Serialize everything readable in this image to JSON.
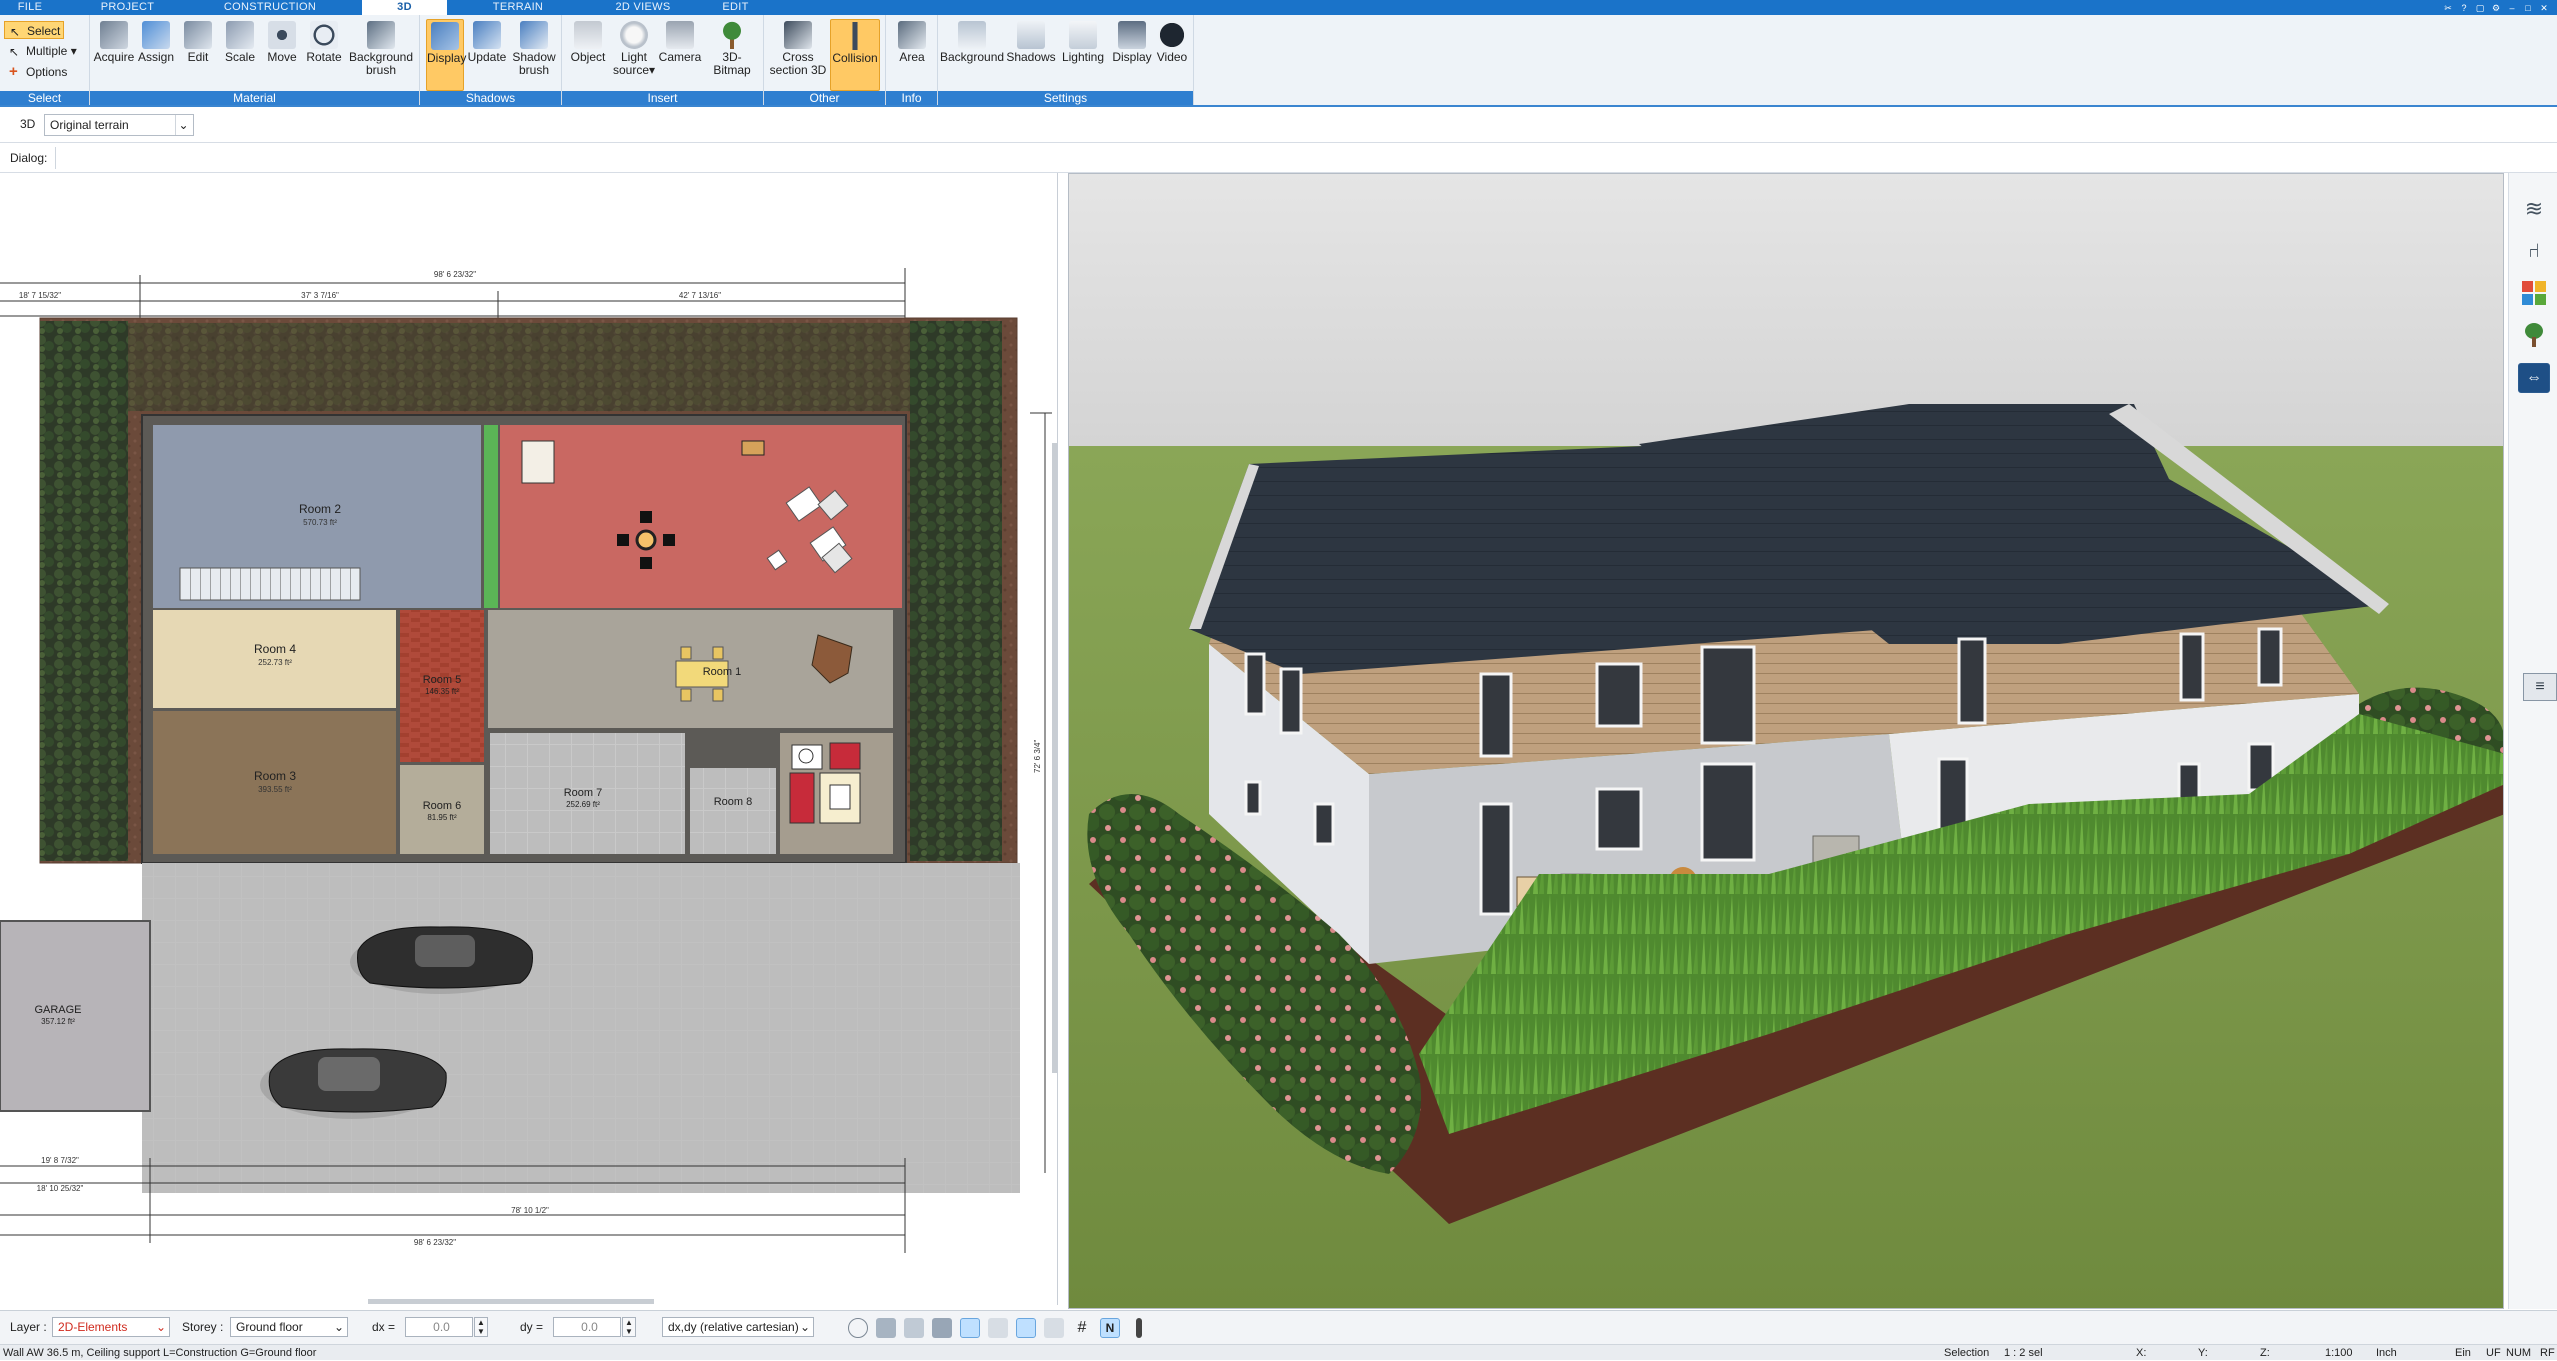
{
  "tabs": [
    {
      "label": "FILE"
    },
    {
      "label": "PROJECT"
    },
    {
      "label": "CONSTRUCTION"
    },
    {
      "label": "3D"
    },
    {
      "label": "TERRAIN"
    },
    {
      "label": "2D VIEWS"
    },
    {
      "label": "EDIT"
    }
  ],
  "ribbon": {
    "select_group": {
      "label": "Select",
      "select": "Select",
      "multiple": "Multiple",
      "options": "Options"
    },
    "material_group": {
      "label": "Material",
      "buttons": [
        "Acquire",
        "Assign",
        "Edit",
        "Scale",
        "Move",
        "Rotate",
        "Background",
        "brush"
      ]
    },
    "shadows_group": {
      "label": "Shadows",
      "buttons": [
        "Display",
        "Update",
        "Shadow",
        "brush"
      ]
    },
    "insert_group": {
      "label": "Insert",
      "buttons": [
        "Object",
        "Light",
        "source",
        "Camera",
        "3D-Bitmap"
      ]
    },
    "other_group": {
      "label": "Other",
      "buttons": [
        "Cross",
        "section 3D",
        "Collision"
      ]
    },
    "info_group": {
      "label": "Info",
      "buttons": [
        "Area"
      ]
    },
    "settings_group": {
      "label": "Settings",
      "buttons": [
        "Background",
        "Shadows",
        "Lighting",
        "Display",
        "Video"
      ]
    }
  },
  "viewbar": {
    "mode": "3D",
    "terrain": "Original terrain"
  },
  "dialogbar": {
    "label": "Dialog:"
  },
  "plan": {
    "rooms": [
      {
        "name": "Room 2",
        "area": "570.73 ft²"
      },
      {
        "name": "Room 4",
        "area": "252.73 ft²"
      },
      {
        "name": "Room 3",
        "area": "393.55 ft²"
      },
      {
        "name": "Room 5",
        "area": "146.35 ft²"
      },
      {
        "name": "Room 1",
        "area": ""
      },
      {
        "name": "Room 6",
        "area": "81.95 ft²"
      },
      {
        "name": "Room 7",
        "area": "252.69 ft²"
      },
      {
        "name": "Room 8",
        "area": ""
      },
      {
        "name": "GARAGE",
        "area": "357.12 ft²"
      }
    ],
    "dims": {
      "top_total": "98' 6 23/32\"",
      "top_left": "37' 3 7/16\"",
      "top_right": "42' 7 13/16\"",
      "top_far_left": "18' 7 15/32\"",
      "bottom_total": "98' 6 23/32\"",
      "bottom_mid": "78' 10 1/2\"",
      "bottom_left": "19' 8 7/32\"",
      "left_side": "18' 10 25/32\"",
      "right_side": "72' 6 3/4\""
    }
  },
  "optbar": {
    "layer_label": "Layer :",
    "layer_value": "2D-Elements",
    "storey_label": "Storey :",
    "storey_value": "Ground floor",
    "dx_label": "dx =",
    "dx_value": "0.0",
    "dy_label": "dy =",
    "dy_value": "0.0",
    "coord_mode": "dx,dy (relative cartesian)"
  },
  "status": {
    "message": "Wall AW 36.5 m, Ceiling support L=Construction G=Ground floor",
    "selection": "Selection",
    "scale": "1 : 2 sel",
    "x": "X:",
    "y": "Y:",
    "z": "Z:",
    "ratio": "1:100",
    "units": "Inch",
    "ein": "Ein",
    "uf": "UF",
    "num": "NUM",
    "rf": "RF"
  },
  "colors": {
    "accent": "#2f7fd0",
    "highlight": "#ffc964",
    "sky": "#dcdcdc",
    "grass": "#7d9a4a",
    "roof": "#2b333d"
  },
  "icons": {
    "right_panel": [
      "layers-icon",
      "chair-icon",
      "palette-icon",
      "tree-icon",
      "swap-icon",
      "grip-icon"
    ]
  }
}
